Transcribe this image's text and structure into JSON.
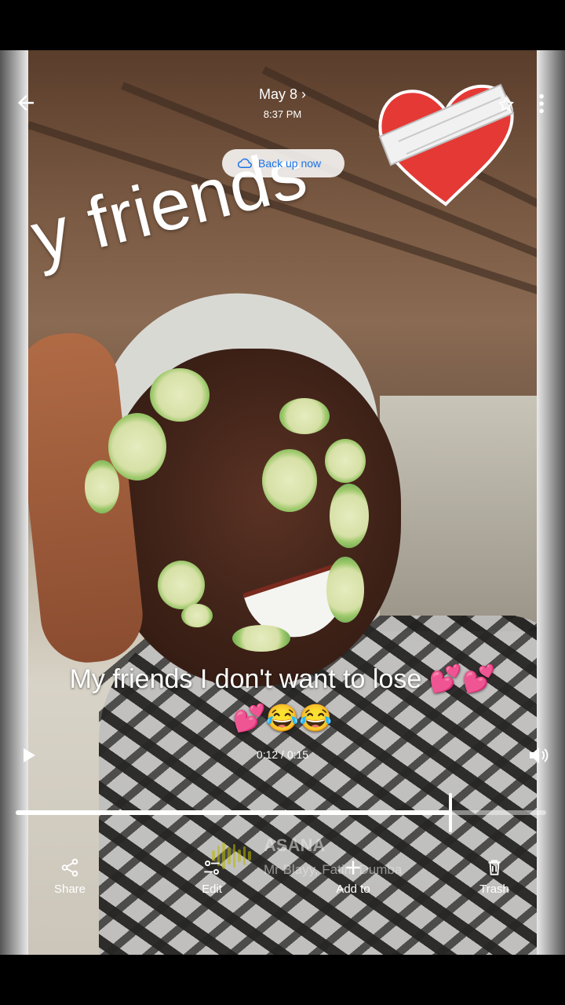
{
  "header": {
    "date": "May 8",
    "time": "8:37 PM"
  },
  "backup_chip": {
    "label": "Back up now"
  },
  "stickers": {
    "friends_text": "y friends"
  },
  "caption": {
    "line1": "My friends I don't want to lose 💕💕",
    "line2": "💕😂😂"
  },
  "player": {
    "time": "0:12 / 0:15",
    "progress_fraction": 0.82
  },
  "music": {
    "title": "ASANA",
    "artist": "Mr Blayy, Fatim Dumba"
  },
  "actions": [
    {
      "label": "Share",
      "icon": "share-icon"
    },
    {
      "label": "Edit",
      "icon": "edit-sliders-icon"
    },
    {
      "label": "Add to",
      "icon": "plus-icon"
    },
    {
      "label": "Trash",
      "icon": "trash-icon"
    }
  ],
  "colors": {
    "backup_text": "#1a73e8",
    "progress": "#ffffff"
  }
}
